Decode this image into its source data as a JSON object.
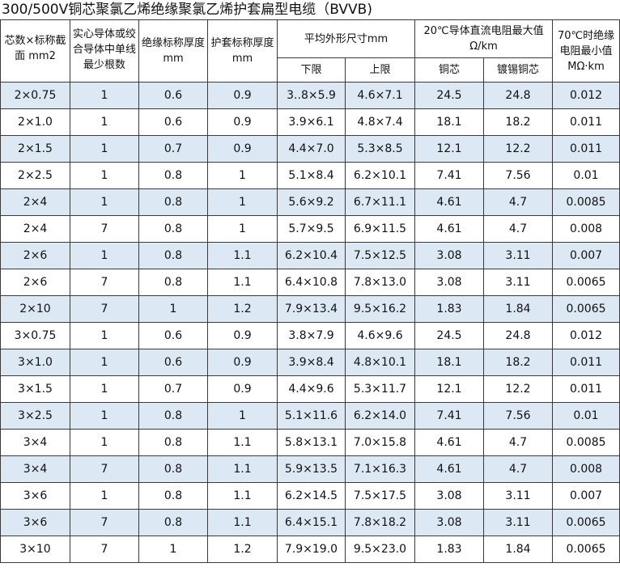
{
  "title": "300/500V铜芯聚氯乙烯绝缘聚氯乙烯护套扁型电缆（BVVB)",
  "headers": {
    "col1": "芯数×标称截面 mm2",
    "col2": "实心导体或绞合导体中单线最少根数",
    "col3": "绝缘标称厚度mm",
    "col4": "护套标称厚度mm",
    "group_dims": "平均外形尺寸mm",
    "dims_lower": "下限",
    "dims_upper": "上限",
    "group_resist": "20℃导体直流电阻最大值 Ω/km",
    "res_copper": "铜芯",
    "res_tinned": "镀锡铜芯",
    "col9": "70℃时绝缘电阻最小值MΩ·km"
  },
  "rows": [
    [
      "2×0.75",
      "1",
      "0.6",
      "0.9",
      "3..8×5.9",
      "4.6×7.1",
      "24.5",
      "24.8",
      "0.012"
    ],
    [
      "2×1.0",
      "1",
      "0.6",
      "0.9",
      "3.9×6.1",
      "4.8×7.4",
      "18.1",
      "18.2",
      "0.011"
    ],
    [
      "2×1.5",
      "1",
      "0.7",
      "0.9",
      "4.4×7.0",
      "5.3×8.5",
      "12.1",
      "12.2",
      "0.011"
    ],
    [
      "2×2.5",
      "1",
      "0.8",
      "1",
      "5.1×8.4",
      "6.2×10.1",
      "7.41",
      "7.56",
      "0.01"
    ],
    [
      "2×4",
      "1",
      "0.8",
      "1",
      "5.6×9.2",
      "6.7×11.1",
      "4.61",
      "4.7",
      "0.0085"
    ],
    [
      "2×4",
      "7",
      "0.8",
      "1",
      "5.7×9.5",
      "6.9×11.5",
      "4.61",
      "4.7",
      "0.008"
    ],
    [
      "2×6",
      "1",
      "0.8",
      "1.1",
      "6.2×10.4",
      "7.5×12.5",
      "3.08",
      "3.11",
      "0.007"
    ],
    [
      "2×6",
      "7",
      "0.8",
      "1.1",
      "6.4×10.8",
      "7.8×13.0",
      "3.08",
      "3.11",
      "0.0065"
    ],
    [
      "2×10",
      "7",
      "1",
      "1.2",
      "7.9×13.4",
      "9.5×16.2",
      "1.83",
      "1.84",
      "0.0065"
    ],
    [
      "3×0.75",
      "1",
      "0.6",
      "0.9",
      "3.8×7.9",
      "4.6×9.6",
      "24.5",
      "24.8",
      "0.012"
    ],
    [
      "3×1.0",
      "1",
      "0.6",
      "0.9",
      "3.9×8.4",
      "4.8×10.1",
      "18.1",
      "18.2",
      "0.011"
    ],
    [
      "3×1.5",
      "1",
      "0.7",
      "0.9",
      "4.4×9.6",
      "5.3×11.7",
      "12.1",
      "12.2",
      "0.011"
    ],
    [
      "3×2.5",
      "1",
      "0.8",
      "1",
      "5.1×11.6",
      "6.2×14.0",
      "7.41",
      "7.56",
      "0.01"
    ],
    [
      "3×4",
      "1",
      "0.8",
      "1.1",
      "5.8×13.1",
      "7.0×15.8",
      "4.61",
      "4.7",
      "0.0085"
    ],
    [
      "3×4",
      "7",
      "0.8",
      "1.1",
      "5.9×13.5",
      "7.1×16.3",
      "4.61",
      "4.7",
      "0.008"
    ],
    [
      "3×6",
      "1",
      "0.8",
      "1.1",
      "6.2×14.5",
      "7.5×17.5",
      "3.08",
      "3.11",
      "0.007"
    ],
    [
      "3×6",
      "7",
      "0.8",
      "1.1",
      "6.4×15.1",
      "7.8×18.2",
      "3.08",
      "3.11",
      "0.0065"
    ],
    [
      "3×10",
      "7",
      "1",
      "1.2",
      "7.9×19.0",
      "9.5×23.0",
      "1.83",
      "1.84",
      "0.0065"
    ]
  ],
  "colors": {
    "band": "#dde8f5",
    "border": "#3a3a3a"
  }
}
